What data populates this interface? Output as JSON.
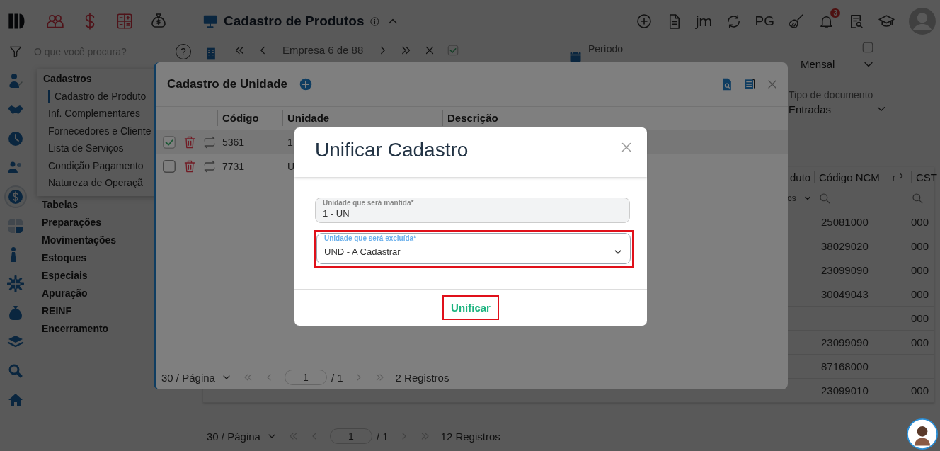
{
  "header": {
    "title": "Cadastro de Produtos",
    "tool_label": "jm",
    "pg_label": "PG",
    "notification_count": "3"
  },
  "search": {
    "placeholder": "O que você procura?",
    "help": "?"
  },
  "company": {
    "label": "Empresa 6 de 88",
    "confirmed": true
  },
  "period": {
    "label": "Período",
    "mode": "Mensal",
    "checked": false
  },
  "document_type": {
    "label": "Tipo de documento",
    "value": "Entradas"
  },
  "rail": [
    {
      "selected": false
    },
    {
      "selected": false
    },
    {
      "selected": false
    },
    {
      "selected": false
    },
    {
      "selected": true
    },
    {
      "selected": false
    },
    {
      "selected": false
    },
    {
      "selected": false
    },
    {
      "selected": false
    },
    {
      "selected": false
    },
    {
      "selected": false
    },
    {
      "selected": false
    }
  ],
  "menu": [
    {
      "label": "Cadastros",
      "expanded": true,
      "children": [
        {
          "label": "Cadastro de Produto",
          "selected": true
        },
        {
          "label": "Inf. Complementares",
          "selected": false
        },
        {
          "label": "Fornecedores e Cliente",
          "selected": false
        },
        {
          "label": "Lista de Serviços",
          "selected": false
        },
        {
          "label": "Condição Pagamento",
          "selected": false
        },
        {
          "label": "Natureza de Operaçã",
          "selected": false
        }
      ]
    },
    {
      "label": "Tabelas",
      "expanded": false
    },
    {
      "label": "Preparações",
      "expanded": false
    },
    {
      "label": "Movimentações",
      "expanded": false
    },
    {
      "label": "Estoques",
      "expanded": false
    },
    {
      "label": "Especiais",
      "expanded": false
    },
    {
      "label": "Apuração",
      "expanded": false
    },
    {
      "label": "REINF",
      "expanded": false
    },
    {
      "label": "Encerramento",
      "expanded": false
    }
  ],
  "products_table": {
    "columns": [
      "duto",
      "Código NCM",
      "CST"
    ],
    "filter": "os",
    "rows": [
      {
        "ncm": "25081000",
        "cst": "000"
      },
      {
        "ncm": "38029020",
        "cst": "000"
      },
      {
        "ncm": "23099090",
        "cst": "000"
      },
      {
        "ncm": "30049043",
        "cst": "000"
      },
      {
        "cst": "000"
      },
      {
        "ncm": "23099090",
        "cst": "000"
      },
      {
        "ncm": "87168000"
      },
      {
        "ncm": "23099010",
        "cst": "000"
      }
    ]
  },
  "products_pagination": {
    "page_size": "30 / Página",
    "page": "1",
    "page_count": "/ 1",
    "total": "12 Registros"
  },
  "unit_panel": {
    "title": "Cadastro de Unidade",
    "columns": [
      "Código",
      "Unidade",
      "Descrição"
    ],
    "rows": [
      {
        "checked": true,
        "code": "5361",
        "unit": "1"
      },
      {
        "checked": false,
        "code": "7731",
        "unit": "U"
      }
    ],
    "pagination": {
      "page_size": "30 / Página",
      "page": "1",
      "page_count": "/ 1",
      "total": "2 Registros"
    }
  },
  "merge_dialog": {
    "title": "Unificar Cadastro",
    "fields": [
      {
        "kind": "input",
        "label": "Unidade que será mantida*",
        "value": "1 - UN",
        "disabled": true,
        "focused": false,
        "highlighted": false
      },
      {
        "kind": "select",
        "label": "Unidade que será excluída*",
        "value": "UND - A Cadastrar",
        "disabled": false,
        "focused": true,
        "highlighted": true
      }
    ],
    "button": {
      "label": "Unificar",
      "highlighted": true
    }
  }
}
